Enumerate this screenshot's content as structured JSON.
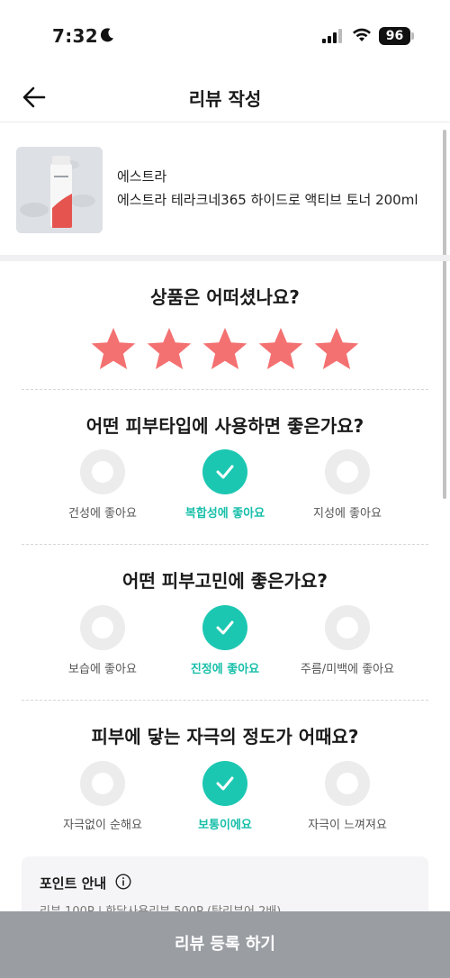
{
  "status_bar": {
    "time": "7:32",
    "battery": "96"
  },
  "header": {
    "title": "리뷰 작성"
  },
  "product": {
    "brand": "에스트라",
    "name": "에스트라 테라크네365 하이드로 액티브 토너 200ml"
  },
  "rating": {
    "question": "상품은 어떠셨나요?",
    "stars": 5,
    "max_stars": 5,
    "star_color": "#f47172"
  },
  "skin_type": {
    "question": "어떤 피부타입에 사용하면 좋은가요?",
    "options": [
      {
        "label": "건성에 좋아요",
        "selected": false
      },
      {
        "label": "복합성에 좋아요",
        "selected": true
      },
      {
        "label": "지성에 좋아요",
        "selected": false
      }
    ]
  },
  "skin_concern": {
    "question": "어떤 피부고민에 좋은가요?",
    "options": [
      {
        "label": "보습에 좋아요",
        "selected": false
      },
      {
        "label": "진정에 좋아요",
        "selected": true
      },
      {
        "label": "주름/미백에 좋아요",
        "selected": false
      }
    ]
  },
  "irritation": {
    "question": "피부에 닿는 자극의 정도가 어때요?",
    "options": [
      {
        "label": "자극없이 순해요",
        "selected": false
      },
      {
        "label": "보통이에요",
        "selected": true
      },
      {
        "label": "자극이 느껴져요",
        "selected": false
      }
    ]
  },
  "notice": {
    "title": "포인트 안내",
    "line": "리뷰 100P | 한달사용리뷰 500P (탑리뷰어 2배)"
  },
  "submit": {
    "label": "리뷰 등록 하기"
  },
  "colors": {
    "accent": "#1cc7b2",
    "star": "#f47172",
    "submit_bg": "#9a9ea3"
  }
}
